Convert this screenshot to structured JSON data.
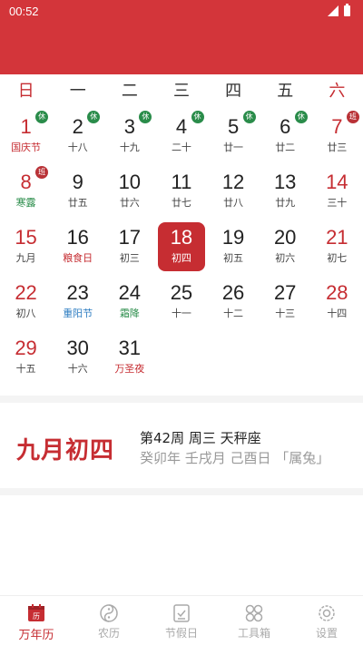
{
  "status": {
    "time": "00:52"
  },
  "weekdays": [
    "日",
    "一",
    "二",
    "三",
    "四",
    "五",
    "六"
  ],
  "weeks": [
    [
      {
        "day": "1",
        "sub": "国庆节",
        "badge": "休"
      },
      {
        "day": "2",
        "sub": "十八",
        "badge": "休"
      },
      {
        "day": "3",
        "sub": "十九",
        "badge": "休"
      },
      {
        "day": "4",
        "sub": "二十",
        "badge": "休"
      },
      {
        "day": "5",
        "sub": "廿一",
        "badge": "休"
      },
      {
        "day": "6",
        "sub": "廿二",
        "badge": "休"
      },
      {
        "day": "7",
        "sub": "廿三",
        "badge": "班"
      }
    ],
    [
      {
        "day": "8",
        "sub": "寒露",
        "badge": "班"
      },
      {
        "day": "9",
        "sub": "廿五"
      },
      {
        "day": "10",
        "sub": "廿六"
      },
      {
        "day": "11",
        "sub": "廿七"
      },
      {
        "day": "12",
        "sub": "廿八"
      },
      {
        "day": "13",
        "sub": "廿九"
      },
      {
        "day": "14",
        "sub": "三十"
      }
    ],
    [
      {
        "day": "15",
        "sub": "九月"
      },
      {
        "day": "16",
        "sub": "粮食日"
      },
      {
        "day": "17",
        "sub": "初三"
      },
      {
        "day": "18",
        "sub": "初四"
      },
      {
        "day": "19",
        "sub": "初五"
      },
      {
        "day": "20",
        "sub": "初六"
      },
      {
        "day": "21",
        "sub": "初七"
      }
    ],
    [
      {
        "day": "22",
        "sub": "初八"
      },
      {
        "day": "23",
        "sub": "重阳节"
      },
      {
        "day": "24",
        "sub": "霜降"
      },
      {
        "day": "25",
        "sub": "十一"
      },
      {
        "day": "26",
        "sub": "十二"
      },
      {
        "day": "27",
        "sub": "十三"
      },
      {
        "day": "28",
        "sub": "十四"
      }
    ],
    [
      {
        "day": "29",
        "sub": "十五"
      },
      {
        "day": "30",
        "sub": "十六"
      },
      {
        "day": "31",
        "sub": "万圣夜"
      }
    ]
  ],
  "info": {
    "lunar_date": "九月初四",
    "line1": "第42周 周三 天秤座",
    "line2": "癸卯年 壬戌月 己酉日 「属兔」"
  },
  "nav": [
    {
      "label": "万年历",
      "icon": "calendar-icon"
    },
    {
      "label": "农历",
      "icon": "yin-yang-icon"
    },
    {
      "label": "节假日",
      "icon": "checklist-icon"
    },
    {
      "label": "工具箱",
      "icon": "grid-icon"
    },
    {
      "label": "设置",
      "icon": "gear-icon"
    }
  ],
  "colors": {
    "accent": "#d3353a",
    "weekend": "#c62d32",
    "rest_badge": "#2a8c4a",
    "solar_term": "#2a8c4a",
    "festival_blue": "#2e7dc2"
  }
}
